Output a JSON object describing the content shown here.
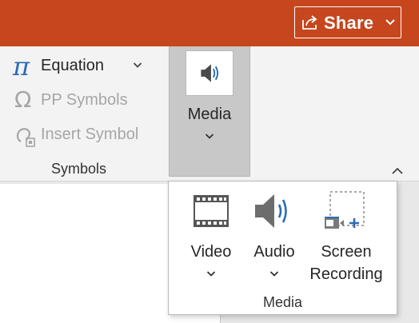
{
  "titlebar": {
    "share_label": "Share",
    "accent": "#c6461e"
  },
  "symbols_group": {
    "equation_label": "Equation",
    "pp_symbols_label": "PP Symbols",
    "insert_symbol_label": "Insert Symbol",
    "group_label": "Symbols",
    "equation_glyph": "π",
    "pp_glyph": "Ω"
  },
  "media_button": {
    "label": "Media",
    "icon": "speaker-icon"
  },
  "media_dropdown": {
    "items": [
      {
        "label": "Video",
        "icon": "film-icon"
      },
      {
        "label": "Audio",
        "icon": "speaker-icon"
      },
      {
        "label_line1": "Screen",
        "label_line2": "Recording",
        "icon": "screen-recording-icon"
      }
    ],
    "group_label": "Media"
  }
}
